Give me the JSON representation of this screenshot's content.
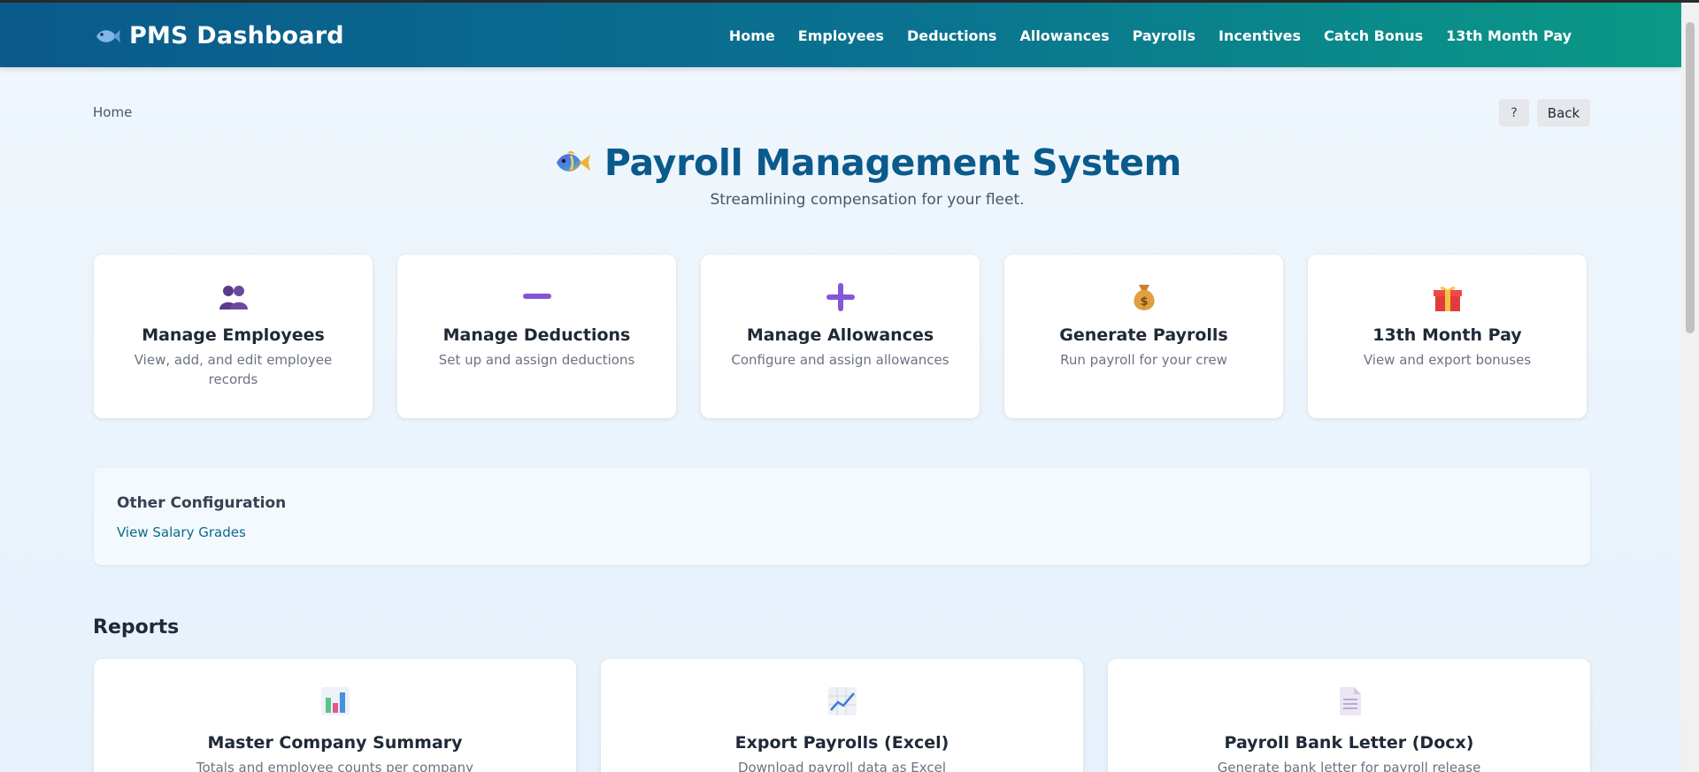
{
  "brand": {
    "title": "PMS Dashboard"
  },
  "nav": [
    "Home",
    "Employees",
    "Deductions",
    "Allowances",
    "Payrolls",
    "Incentives",
    "Catch Bonus",
    "13th Month Pay"
  ],
  "breadcrumb": "Home",
  "buttons": {
    "help": "?",
    "back": "Back"
  },
  "hero": {
    "title": "Payroll Management System",
    "subtitle": "Streamlining compensation for your fleet."
  },
  "cards": [
    {
      "title": "Manage Employees",
      "desc": "View, add, and edit employee records",
      "icon": "people-icon"
    },
    {
      "title": "Manage Deductions",
      "desc": "Set up and assign deductions",
      "icon": "minus-icon"
    },
    {
      "title": "Manage Allowances",
      "desc": "Configure and assign allowances",
      "icon": "plus-icon"
    },
    {
      "title": "Generate Payrolls",
      "desc": "Run payroll for your crew",
      "icon": "money-bag-icon"
    },
    {
      "title": "13th Month Pay",
      "desc": "View and export bonuses",
      "icon": "gift-icon"
    }
  ],
  "config": {
    "title": "Other Configuration",
    "link": "View Salary Grades"
  },
  "reports": {
    "title": "Reports",
    "items": [
      {
        "title": "Master Company Summary",
        "desc": "Totals and employee counts per company",
        "icon": "bar-chart-icon"
      },
      {
        "title": "Export Payrolls (Excel)",
        "desc": "Download payroll data as Excel",
        "icon": "line-chart-icon"
      },
      {
        "title": "Payroll Bank Letter (Docx)",
        "desc": "Generate bank letter for payroll release",
        "icon": "document-icon"
      }
    ]
  },
  "colors": {
    "primary": "#0a5a8c",
    "accent": "#0a9a86",
    "link": "#0a6a8c"
  }
}
